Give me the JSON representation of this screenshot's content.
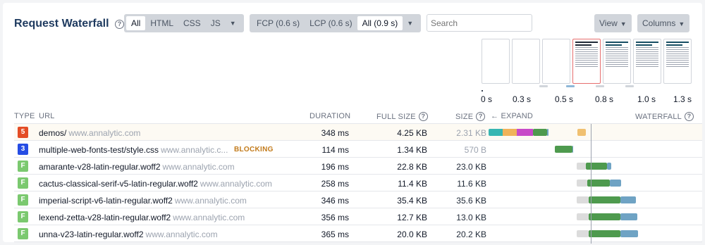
{
  "title": "Request Waterfall",
  "type_filter": {
    "options": [
      "All",
      "HTML",
      "CSS",
      "JS"
    ],
    "selected": "All"
  },
  "timing_filter": {
    "options": [
      "FCP (0.6 s)",
      "LCP (0.6 s)",
      "All (0.9 s)"
    ],
    "selected": "All (0.9 s)"
  },
  "search": {
    "placeholder": "Search"
  },
  "view_label": "View",
  "columns_label": "Columns",
  "timeline_ticks": [
    "0 s",
    "0.3 s",
    "0.5 s",
    "0.8 s",
    "1.0 s",
    "1.3 s"
  ],
  "filmstrip": [
    {
      "state": "blank"
    },
    {
      "state": "blank"
    },
    {
      "state": "blank"
    },
    {
      "state": "rendered",
      "text": "William Shakespeare: As You Like It"
    },
    {
      "state": "rendered",
      "text": "William Shakespeare: As You Like It"
    },
    {
      "state": "rendered",
      "text": "William Shakespeare: As You Like It"
    },
    {
      "state": "rendered",
      "text": "William Shakespeare: As You Like It"
    }
  ],
  "columns": {
    "type": "TYPE",
    "url": "URL",
    "duration": "DURATION",
    "full_size": "FULL SIZE",
    "size": "SIZE",
    "expand": "← EXPAND",
    "waterfall": "WATERFALL"
  },
  "rows": [
    {
      "type": "html",
      "icon": "html5-icon",
      "icon_text": "5",
      "file": "demos/",
      "host": "www.annalytic.com",
      "badge": "",
      "duration": "348 ms",
      "full_size": "4.25 KB",
      "size": "2.31 KB"
    },
    {
      "type": "css",
      "icon": "css3-icon",
      "icon_text": "3",
      "file": "multiple-web-fonts-test/style.css",
      "host": "www.annalytic.c...",
      "badge": "BLOCKING",
      "duration": "114 ms",
      "full_size": "1.34 KB",
      "size": "570 B"
    },
    {
      "type": "font",
      "icon": "font-icon",
      "icon_text": "F",
      "file": "amarante-v28-latin-regular.woff2",
      "host": "www.annalytic.com",
      "badge": "",
      "duration": "196 ms",
      "full_size": "22.8 KB",
      "size": "23.0 KB"
    },
    {
      "type": "font",
      "icon": "font-icon",
      "icon_text": "F",
      "file": "cactus-classical-serif-v5-latin-regular.woff2",
      "host": "www.annalytic.com",
      "badge": "",
      "duration": "258 ms",
      "full_size": "11.4 KB",
      "size": "11.6 KB"
    },
    {
      "type": "font",
      "icon": "font-icon",
      "icon_text": "F",
      "file": "imperial-script-v6-latin-regular.woff2",
      "host": "www.annalytic.com",
      "badge": "",
      "duration": "346 ms",
      "full_size": "35.4 KB",
      "size": "35.6 KB"
    },
    {
      "type": "font",
      "icon": "font-icon",
      "icon_text": "F",
      "file": "lexend-zetta-v28-latin-regular.woff2",
      "host": "www.annalytic.com",
      "badge": "",
      "duration": "356 ms",
      "full_size": "12.7 KB",
      "size": "13.0 KB"
    },
    {
      "type": "font",
      "icon": "font-icon",
      "icon_text": "F",
      "file": "unna-v23-latin-regular.woff2",
      "host": "www.annalytic.com",
      "badge": "",
      "duration": "365 ms",
      "full_size": "20.0 KB",
      "size": "20.2 KB"
    }
  ],
  "colors": {
    "dns": "#37b6b2",
    "connect": "#f0b35a",
    "ssl": "#c84ac8",
    "download": "#4e9a4e",
    "ttfb": "#dcdcdc",
    "content": "#6fa3c4",
    "html": "#e44d26",
    "css": "#264de4",
    "font": "#7bc96f"
  }
}
